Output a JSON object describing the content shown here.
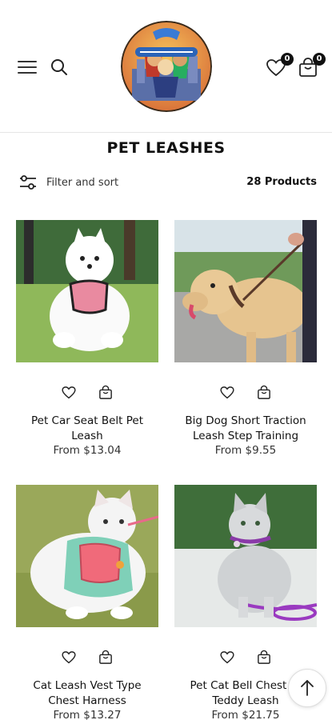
{
  "header": {
    "menu_icon": "hamburger-menu-icon",
    "search_icon": "search-icon",
    "wishlist_icon": "heart-icon",
    "wishlist_count": "0",
    "cart_icon": "shopping-bag-icon",
    "cart_count": "0"
  },
  "page": {
    "title": "PET LEASHES",
    "filter_label": "Filter and sort",
    "filter_icon": "sliders-icon",
    "product_count": "28 Products"
  },
  "products": [
    {
      "title_line1": "Pet Car Seat Belt Pet",
      "title_line2": "Leash",
      "price": "From $13.04"
    },
    {
      "title_line1": "Big Dog Short Traction",
      "title_line2": "Leash Step Training",
      "price": "From $9.55"
    },
    {
      "title_line1": "Cat Leash Vest Type",
      "title_line2": "Chest Harness",
      "price": "From $13.27"
    },
    {
      "title_line1": "Pet Cat Bell Chest St",
      "title_line2": "Teddy Leash",
      "price": "From $21.75"
    }
  ],
  "colors": {
    "text": "#111111",
    "badge": "#111111",
    "border": "#e6e6e6"
  },
  "scroll_top_icon": "arrow-up-icon"
}
